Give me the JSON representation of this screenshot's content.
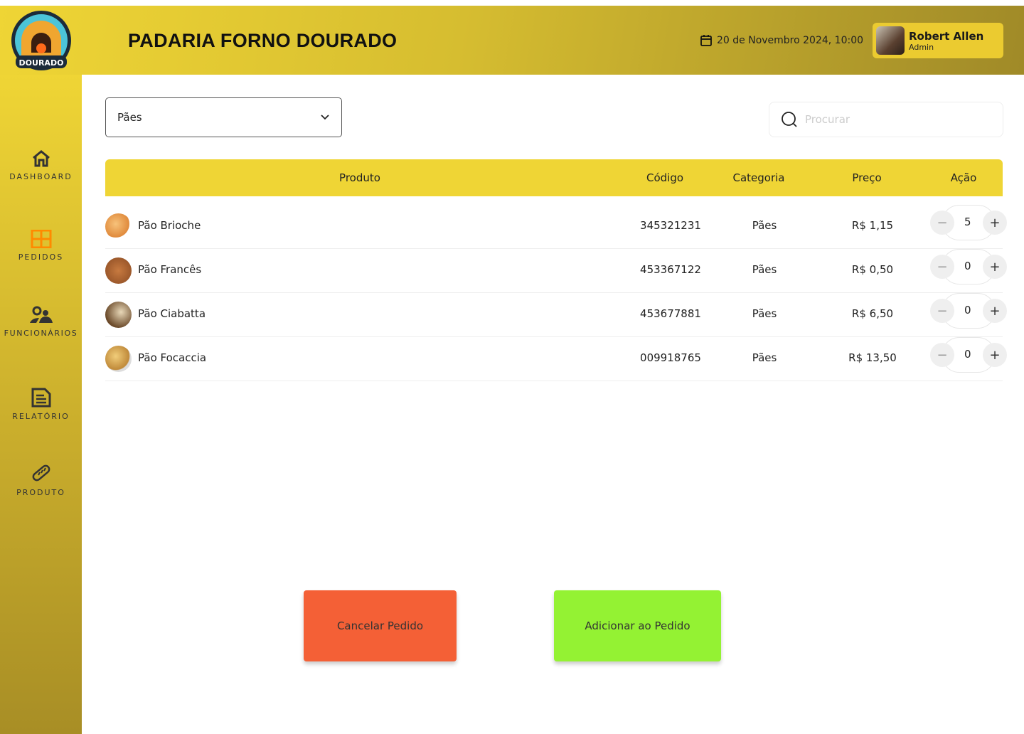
{
  "header": {
    "logo_text": "FORNO DOURADO",
    "title": "PADARIA FORNO DOURADO",
    "datetime": "20 de Novembro 2024, 10:00",
    "user": {
      "name": "Robert Allen",
      "role": "Admin"
    }
  },
  "sidebar": {
    "items": [
      {
        "label": "DASHBOARD",
        "icon": "home-icon"
      },
      {
        "label": "PEDIDOS",
        "icon": "grid-icon",
        "active": true,
        "active_color": "#ff8a00"
      },
      {
        "label": "FUNCIONÁRIOS",
        "icon": "users-icon"
      },
      {
        "label": "RELATÓRIO",
        "icon": "report-icon"
      },
      {
        "label": "PRODUTO",
        "icon": "bread-icon"
      }
    ]
  },
  "filter": {
    "selected": "Pães"
  },
  "search": {
    "placeholder": "Procurar",
    "value": ""
  },
  "table": {
    "headers": [
      "Produto",
      "Código",
      "Categoria",
      "Preço",
      "Ação"
    ],
    "rows": [
      {
        "product": "Pão Brioche",
        "code": "345321231",
        "category": "Pães",
        "price": "R$ 1,15",
        "qty": "5"
      },
      {
        "product": "Pão Francês",
        "code": "453367122",
        "category": "Pães",
        "price": "R$ 0,50",
        "qty": "0"
      },
      {
        "product": "Pão Ciabatta",
        "code": "453677881",
        "category": "Pães",
        "price": "R$ 6,50",
        "qty": "0"
      },
      {
        "product": "Pão Focaccia",
        "code": "009918765",
        "category": "Pães",
        "price": "R$ 13,50",
        "qty": "0"
      }
    ]
  },
  "actions": {
    "cancel": "Cancelar Pedido",
    "add": "Adicionar ao Pedido",
    "cancel_color": "#f46036",
    "add_color": "#94f233"
  }
}
